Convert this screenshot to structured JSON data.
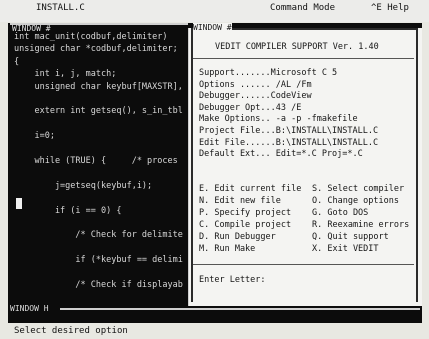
{
  "topbar": {
    "file": "INSTALL.C",
    "mode": "Command Mode",
    "help": "^E Help"
  },
  "editor": {
    "window_label": "WINDOW #",
    "lines": [
      "int mac_unit(codbuf,delimiter)",
      "unsigned char *codbuf,delimiter;",
      "{",
      "    int i, j, match;",
      "    unsigned char keybuf[MAXSTR],",
      "",
      "    extern int getseq(), s_in_tbl",
      "",
      "    i=0;",
      "",
      "    while (TRUE) {     /* proces",
      "",
      "        j=getseq(keybuf,i);",
      "",
      "        if (i == 0) {",
      "",
      "            /* Check for delimite",
      "",
      "            if (*keybuf == delimi",
      "",
      "            /* Check if displayab"
    ]
  },
  "menu_window": {
    "window_label": "WINDOW #",
    "title": "VEDIT COMPILER SUPPORT Ver. 1.40",
    "config": [
      "Support.......Microsoft C 5",
      "Options ...... /AL /Fm",
      "Debugger......CodeView",
      "Debugger Opt...43 /E",
      "Make Options.. -a -p -fmakefile",
      "Project File...B:\\INSTALL\\INSTALL.C",
      "Edit File......B:\\INSTALL\\INSTALL.C",
      "Default Ext... Edit=*.C Proj=*.C"
    ],
    "commands_left": [
      "E. Edit current file",
      "N. Edit new file",
      "P. Specify project",
      "C. Compile project",
      "D. Run Debugger",
      "M. Run Make"
    ],
    "commands_right": [
      "S. Select compiler",
      "O. Change options",
      "G. Goto DOS",
      "R. Reexamine errors",
      "Q. Quit support",
      "X. Exit VEDIT"
    ],
    "prompt": "Enter Letter:"
  },
  "bottom_window": {
    "window_label": "WINDOW H"
  },
  "status_line": "Select desired option",
  "colors": {
    "editor_bg": "#0c0c0c",
    "editor_text": "#d8d8d8",
    "menu_bg": "#f4f4f2",
    "menu_text": "#161616",
    "bar_bg": "#e8e8e2"
  }
}
